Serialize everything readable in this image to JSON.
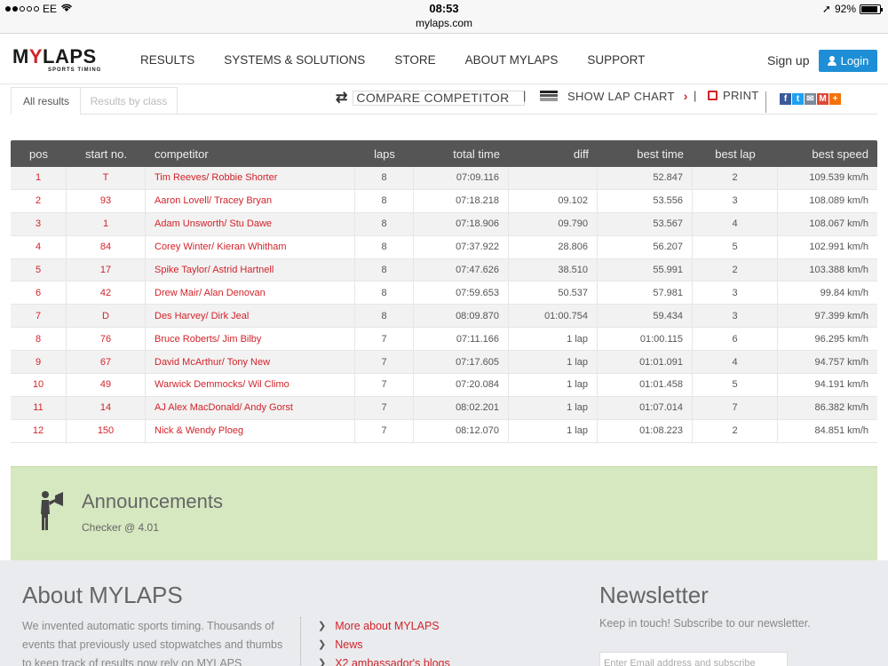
{
  "statusbar": {
    "carrier": "EE",
    "time": "08:53",
    "url": "mylaps.com",
    "battery": "92%"
  },
  "nav": {
    "logo_text": "MYLAPS",
    "logo_tagline": "SPORTS TIMING",
    "menu": [
      "RESULTS",
      "SYSTEMS & SOLUTIONS",
      "STORE",
      "ABOUT MYLAPS",
      "SUPPORT"
    ],
    "signup": "Sign up",
    "login": "Login"
  },
  "toolbar": {
    "tab_all": "All results",
    "tab_class": "Results by class",
    "compare": "COMPARE COMPETITOR",
    "lap_chart": "SHOW LAP CHART",
    "print": "PRINT",
    "separator": "|"
  },
  "social": [
    {
      "icon": "facebook-icon",
      "glyph": "f",
      "color": "#3b5998"
    },
    {
      "icon": "twitter-icon",
      "glyph": "t",
      "color": "#1da1f2"
    },
    {
      "icon": "email-icon",
      "glyph": "✉",
      "color": "#7a8a99"
    },
    {
      "icon": "gmail-icon",
      "glyph": "M",
      "color": "#dd4b39"
    },
    {
      "icon": "plus-icon",
      "glyph": "+",
      "color": "#f4730b"
    }
  ],
  "table": {
    "headers": [
      "pos",
      "start no.",
      "competitor",
      "laps",
      "total time",
      "diff",
      "best time",
      "best lap",
      "best speed"
    ],
    "rows": [
      [
        "1",
        "T",
        "Tim Reeves/ Robbie Shorter",
        "8",
        "07:09.116",
        "",
        "52.847",
        "2",
        "109.539 km/h"
      ],
      [
        "2",
        "93",
        "Aaron Lovell/ Tracey Bryan",
        "8",
        "07:18.218",
        "09.102",
        "53.556",
        "3",
        "108.089 km/h"
      ],
      [
        "3",
        "1",
        "Adam Unsworth/ Stu Dawe",
        "8",
        "07:18.906",
        "09.790",
        "53.567",
        "4",
        "108.067 km/h"
      ],
      [
        "4",
        "84",
        "Corey Winter/ Kieran Whitham",
        "8",
        "07:37.922",
        "28.806",
        "56.207",
        "5",
        "102.991 km/h"
      ],
      [
        "5",
        "17",
        "Spike Taylor/ Astrid Hartnell",
        "8",
        "07:47.626",
        "38.510",
        "55.991",
        "2",
        "103.388 km/h"
      ],
      [
        "6",
        "42",
        "Drew Mair/ Alan Denovan",
        "8",
        "07:59.653",
        "50.537",
        "57.981",
        "3",
        "99.84 km/h"
      ],
      [
        "7",
        "D",
        "Des Harvey/ Dirk Jeal",
        "8",
        "08:09.870",
        "01:00.754",
        "59.434",
        "3",
        "97.399 km/h"
      ],
      [
        "8",
        "76",
        "Bruce Roberts/ Jim Bilby",
        "7",
        "07:11.166",
        "1 lap",
        "01:00.115",
        "6",
        "96.295 km/h"
      ],
      [
        "9",
        "67",
        "David McArthur/ Tony New",
        "7",
        "07:17.605",
        "1 lap",
        "01:01.091",
        "4",
        "94.757 km/h"
      ],
      [
        "10",
        "49",
        "Warwick Demmocks/ Wil Climo",
        "7",
        "07:20.084",
        "1 lap",
        "01:01.458",
        "5",
        "94.191 km/h"
      ],
      [
        "11",
        "14",
        "AJ Alex MacDonald/ Andy Gorst",
        "7",
        "08:02.201",
        "1 lap",
        "01:07.014",
        "7",
        "86.382 km/h"
      ],
      [
        "12",
        "150",
        "Nick & Wendy Ploeg",
        "7",
        "08:12.070",
        "1 lap",
        "01:08.223",
        "2",
        "84.851 km/h"
      ]
    ]
  },
  "announcements": {
    "title": "Announcements",
    "text": "Checker @ 4.01"
  },
  "footer": {
    "about_title": "About MYLAPS",
    "about_text": "We invented automatic sports timing. Thousands of events that previously used stopwatches and thumbs to keep track of results now rely on MYLAPS",
    "links": [
      "More about MYLAPS",
      "News",
      "X2 ambassador's blogs"
    ],
    "newsletter_title": "Newsletter",
    "newsletter_text": "Keep in touch! Subscribe to our newsletter.",
    "email_placeholder": "Enter Email address and subscribe"
  },
  "colors": {
    "accent_red": "#d2232a",
    "login_blue": "#1e8fd6",
    "header_gray": "#555555",
    "announce_green": "#d6e8c0"
  }
}
